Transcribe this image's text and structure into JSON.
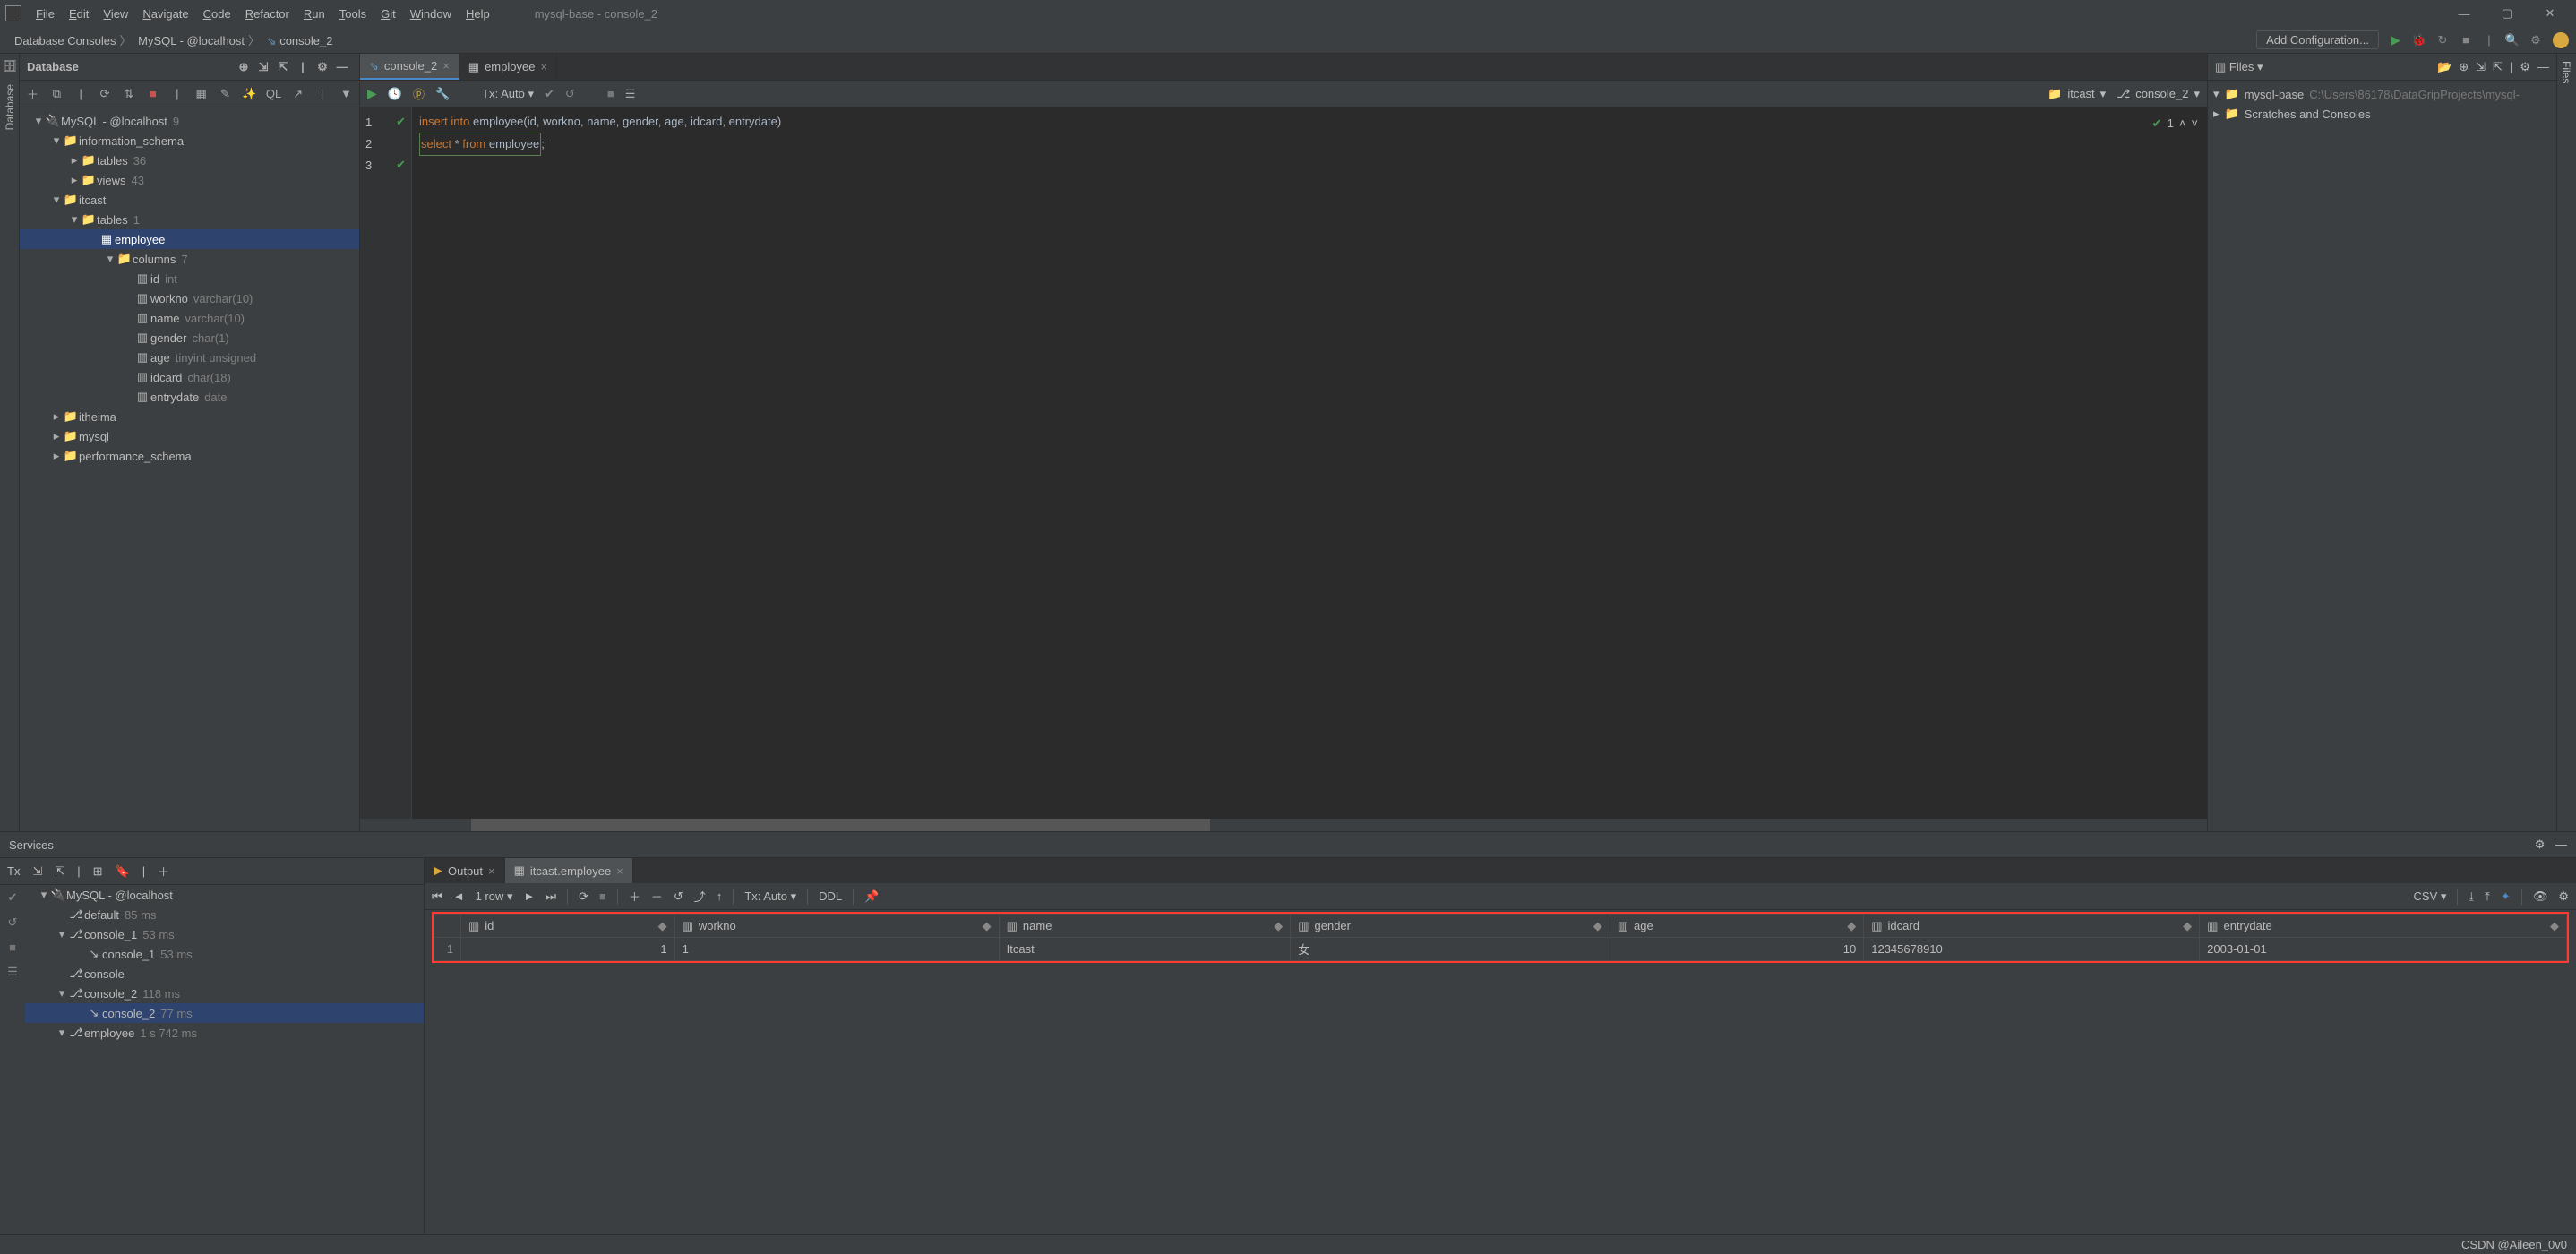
{
  "menu": {
    "items": [
      "File",
      "Edit",
      "View",
      "Navigate",
      "Code",
      "Refactor",
      "Run",
      "Tools",
      "Git",
      "Window",
      "Help"
    ],
    "title": "mysql-base - console_2"
  },
  "breadcrumb": [
    "Database Consoles",
    "MySQL - @localhost",
    "console_2"
  ],
  "nav": {
    "addConfig": "Add Configuration..."
  },
  "dbPanel": {
    "title": "Database",
    "tree": [
      {
        "d": 0,
        "exp": "▾",
        "ic": "🔌",
        "t": "MySQL - @localhost",
        "meta": "9"
      },
      {
        "d": 1,
        "exp": "▾",
        "ic": "📁",
        "t": "information_schema"
      },
      {
        "d": 2,
        "exp": "▸",
        "ic": "📁",
        "t": "tables",
        "meta": "36"
      },
      {
        "d": 2,
        "exp": "▸",
        "ic": "📁",
        "t": "views",
        "meta": "43"
      },
      {
        "d": 1,
        "exp": "▾",
        "ic": "📁",
        "t": "itcast"
      },
      {
        "d": 2,
        "exp": "▾",
        "ic": "📁",
        "t": "tables",
        "meta": "1"
      },
      {
        "d": 3,
        "exp": "",
        "ic": "▦",
        "t": "employee",
        "sel": true
      },
      {
        "d": 4,
        "exp": "▾",
        "ic": "📁",
        "t": "columns",
        "meta": "7"
      },
      {
        "d": 5,
        "exp": "",
        "ic": "▥",
        "t": "id",
        "meta": "int"
      },
      {
        "d": 5,
        "exp": "",
        "ic": "▥",
        "t": "workno",
        "meta": "varchar(10)"
      },
      {
        "d": 5,
        "exp": "",
        "ic": "▥",
        "t": "name",
        "meta": "varchar(10)"
      },
      {
        "d": 5,
        "exp": "",
        "ic": "▥",
        "t": "gender",
        "meta": "char(1)"
      },
      {
        "d": 5,
        "exp": "",
        "ic": "▥",
        "t": "age",
        "meta": "tinyint unsigned"
      },
      {
        "d": 5,
        "exp": "",
        "ic": "▥",
        "t": "idcard",
        "meta": "char(18)"
      },
      {
        "d": 5,
        "exp": "",
        "ic": "▥",
        "t": "entrydate",
        "meta": "date"
      },
      {
        "d": 1,
        "exp": "▸",
        "ic": "📁",
        "t": "itheima"
      },
      {
        "d": 1,
        "exp": "▸",
        "ic": "📁",
        "t": "mysql"
      },
      {
        "d": 1,
        "exp": "▸",
        "ic": "📁",
        "t": "performance_schema"
      }
    ]
  },
  "editor": {
    "tabs": [
      {
        "label": "console_2",
        "active": true
      },
      {
        "label": "employee"
      }
    ],
    "tx": "Tx: Auto",
    "schema": "itcast",
    "session": "console_2",
    "lines": [
      {
        "n": 1,
        "ok": true,
        "html": "<span class='kw'>insert</span> <span class='kw'>into</span> <span class='fn'>employee</span>(<span class='p'>id</span>, <span class='p'>workno</span>, <span class='p'>name</span>, <span class='p'>gender</span>, <span class='p'>age</span>, <span class='p'>idcard</span>, <span class='p'>entrydate</span>)"
      },
      {
        "n": 2,
        "ok": false,
        "html": ""
      },
      {
        "n": 3,
        "ok": true,
        "boxed": true,
        "html": "<span class='kw'>select</span> * <span class='kw'>from</span> <span class='id'>employee</span>"
      }
    ],
    "indicator": "1"
  },
  "files": {
    "title": "Files",
    "rows": [
      {
        "exp": "▾",
        "ic": "📁",
        "t": "mysql-base",
        "path": "C:\\Users\\86178\\DataGripProjects\\mysql-"
      },
      {
        "exp": "▸",
        "ic": "📁",
        "t": "Scratches and Consoles"
      }
    ]
  },
  "services": {
    "title": "Services",
    "txLabel": "Tx",
    "tree": [
      {
        "d": 0,
        "exp": "▾",
        "ic": "🔌",
        "t": "MySQL - @localhost"
      },
      {
        "d": 1,
        "exp": "",
        "ic": "⎇",
        "t": "default",
        "meta": "85 ms"
      },
      {
        "d": 1,
        "exp": "▾",
        "ic": "⎇",
        "t": "console_1",
        "meta": "53 ms"
      },
      {
        "d": 2,
        "exp": "",
        "ic": "↘",
        "t": "console_1",
        "meta": "53 ms"
      },
      {
        "d": 1,
        "exp": "",
        "ic": "⎇",
        "t": "console"
      },
      {
        "d": 1,
        "exp": "▾",
        "ic": "⎇",
        "t": "console_2",
        "meta": "118 ms"
      },
      {
        "d": 2,
        "exp": "",
        "ic": "↘",
        "t": "console_2",
        "meta": "77 ms",
        "sel": true
      },
      {
        "d": 1,
        "exp": "▾",
        "ic": "⎇",
        "t": "employee",
        "meta": "1 s 742 ms"
      }
    ],
    "tabs": [
      {
        "label": "Output"
      },
      {
        "label": "itcast.employee",
        "active": true
      }
    ],
    "rowsLabel": "1 row",
    "tx": "Tx: Auto",
    "ddl": "DDL",
    "csv": "CSV",
    "grid": {
      "headers": [
        "id",
        "workno",
        "name",
        "gender",
        "age",
        "idcard",
        "entrydate"
      ],
      "row": [
        "1",
        "1",
        "Itcast",
        "女",
        "10",
        "12345678910",
        "2003-01-01"
      ],
      "rownum": "1"
    }
  },
  "status": {
    "csdn": "CSDN @Aileen_0v0"
  }
}
